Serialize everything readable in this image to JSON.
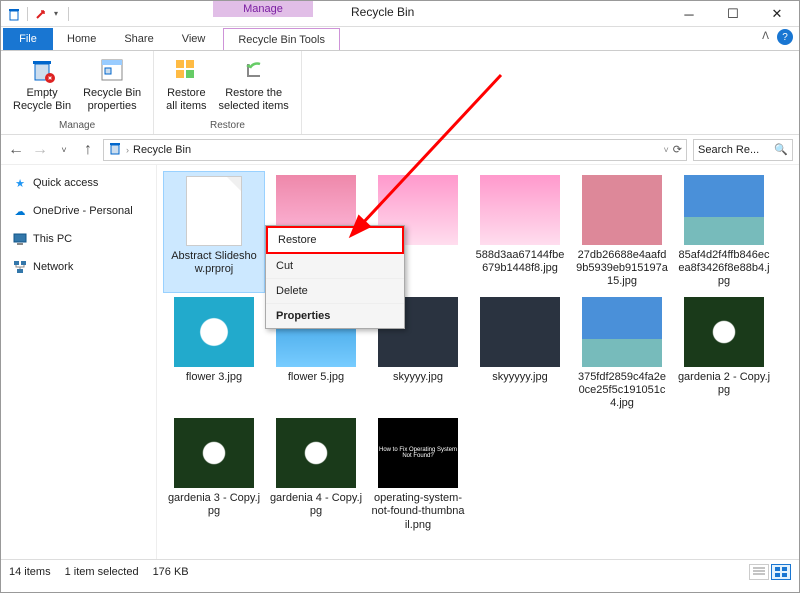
{
  "titlebar": {
    "contextual": "Manage",
    "title": "Recycle Bin"
  },
  "tabs": {
    "file": "File",
    "home": "Home",
    "share": "Share",
    "view": "View",
    "rbt": "Recycle Bin Tools"
  },
  "ribbon": {
    "manage": {
      "label": "Manage",
      "empty": "Empty\nRecycle Bin",
      "props": "Recycle Bin\nproperties"
    },
    "restore": {
      "label": "Restore",
      "all": "Restore\nall items",
      "sel": "Restore the\nselected items"
    }
  },
  "address": {
    "location": "Recycle Bin"
  },
  "search": {
    "placeholder": "Search Re..."
  },
  "sidebar": {
    "items": [
      {
        "label": "Quick access",
        "icon": "star"
      },
      {
        "label": "OneDrive - Personal",
        "icon": "cloud"
      },
      {
        "label": "This PC",
        "icon": "pc"
      },
      {
        "label": "Network",
        "icon": "network"
      }
    ]
  },
  "files": [
    {
      "name": "Abstract Slideshow.prproj",
      "type": "doc",
      "selected": true
    },
    {
      "name": "",
      "type": "pink1"
    },
    {
      "name": "",
      "type": "pink2"
    },
    {
      "name": "588d3aa67144fbe679b1448f8.jpg",
      "type": "pink2"
    },
    {
      "name": "27db26688e4aafd9b5939eb915197a15.jpg",
      "type": "pink3"
    },
    {
      "name": "85af4d2f4ffb846ecea8f3426f8e88b4.jpg",
      "type": "sky"
    },
    {
      "name": "flower 3.jpg",
      "type": "flower3"
    },
    {
      "name": "flower 5.jpg",
      "type": "blue"
    },
    {
      "name": "skyyyy.jpg",
      "type": "dark"
    },
    {
      "name": "skyyyyy.jpg",
      "type": "dark"
    },
    {
      "name": "375fdf2859c4fa2e0ce25f5c191051c4.jpg",
      "type": "sky"
    },
    {
      "name": "gardenia 2 - Copy.jpg",
      "type": "gard"
    },
    {
      "name": "gardenia 3 - Copy.jpg",
      "type": "gard"
    },
    {
      "name": "gardenia 4 - Copy.jpg",
      "type": "gard"
    },
    {
      "name": "operating-system-not-found-thumbnail.png",
      "type": "black"
    }
  ],
  "contextmenu": {
    "restore": "Restore",
    "cut": "Cut",
    "delete": "Delete",
    "properties": "Properties"
  },
  "status": {
    "count": "14 items",
    "selected": "1 item selected",
    "size": "176 KB"
  }
}
